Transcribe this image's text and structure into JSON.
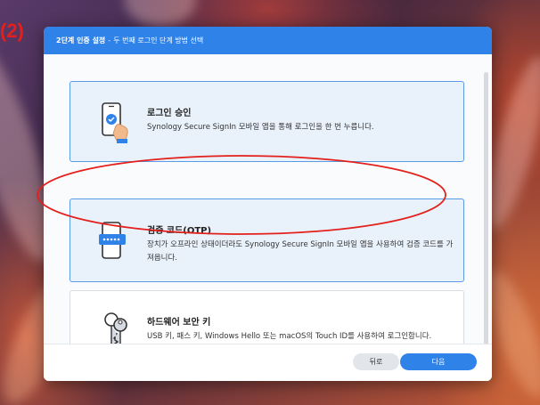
{
  "annotation_label": "(2)",
  "dialog": {
    "title": "2단계 인증 설정",
    "separator": "-",
    "subtitle": "두 번째 로그인 단계 방법 선택"
  },
  "options": [
    {
      "title": "로그인 승인",
      "description": "Synology Secure SignIn 모바일 앱을 통해 로그인을 한 번 누릅니다.",
      "icon": "phone-tap-approve-icon",
      "selected": false
    },
    {
      "title": "검증 코드(OTP)",
      "description": "장치가 오프라인 상태이더라도 Synology Secure SignIn 모바일 앱을 사용하여 검증 코드를 가져옵니다.",
      "icon": "phone-otp-code-icon",
      "selected": true
    },
    {
      "title": "하드웨어 보안 키",
      "description": "USB 키, 패스 키, Windows Hello 또는 macOS의 Touch ID를 사용하여 로그인합니다.",
      "icon": "keys-icon",
      "selected": false
    }
  ],
  "footer": {
    "back_label": "뒤로",
    "next_label": "다음"
  },
  "colors": {
    "accent": "#2f82e8",
    "annotation": "#e3201b"
  }
}
